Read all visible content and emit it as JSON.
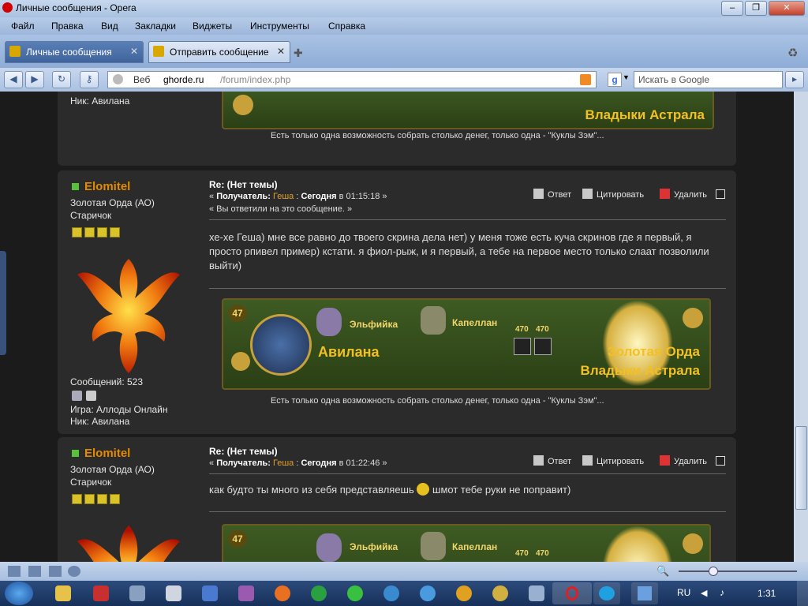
{
  "window": {
    "title": "Личные сообщения - Opera"
  },
  "menu": [
    "Файл",
    "Правка",
    "Вид",
    "Закладки",
    "Виджеты",
    "Инструменты",
    "Справка"
  ],
  "tabs": [
    {
      "label": "Личные сообщения"
    },
    {
      "label": "Отправить сообщение"
    }
  ],
  "address": {
    "web_label": "Веб",
    "domain": "ghorde.ru",
    "path": "/forum/index.php"
  },
  "search": {
    "placeholder": "Искать в Google"
  },
  "top_partial": {
    "nick": "Ник: Авилана",
    "banner_guild": "Владыки Астрала",
    "signature": "Есть только одна возможность собрать столько денег, только одна - \"Куклы Зэм\"..."
  },
  "posts": [
    {
      "username": "Elomitel",
      "guild": "Золотая Орда (АО)",
      "rank": "Старичок",
      "messages": "Сообщений: 523",
      "game": "Игра: Аллоды Онлайн",
      "nick": "Ник: Авилана",
      "subject": "Re: (Нет темы)",
      "recipient_label": "Получатель:",
      "recipient": "Геша",
      "date_bold": "Сегодня",
      "date_rest": "в 01:15:18",
      "replied_note": "« Вы ответили на это сообщение. »",
      "body": "хе-хе Геша) мне все равно до твоего скрина дела нет) у меня тоже есть куча скринов где я первый, я просто рпивел пример) кстати. я фиол-рыж, и я первый, а тебе на первое место только слаат позволили выйти)",
      "banner": {
        "level": "47",
        "race": "Эльфийка",
        "class": "Капеллан",
        "stat1": "470",
        "stat2": "470",
        "name": "Авилана",
        "guild1": "Золотая Орда",
        "guild2": "Владыки Астрала"
      },
      "signature": "Есть только одна возможность собрать столько денег, только одна - \"Куклы Зэм\"..."
    },
    {
      "username": "Elomitel",
      "guild": "Золотая Орда (АО)",
      "rank": "Старичок",
      "subject": "Re: (Нет темы)",
      "recipient_label": "Получатель:",
      "recipient": "Геша",
      "date_bold": "Сегодня",
      "date_rest": "в 01:22:46",
      "body": "как будто ты много из себя представляешь",
      "body_after": "шмот тебе руки не поправит)",
      "banner": {
        "level": "47",
        "race": "Эльфийка",
        "class": "Капеллан",
        "stat1": "470",
        "stat2": "470"
      }
    }
  ],
  "actions": {
    "reply": "Ответ",
    "quote": "Цитировать",
    "delete": "Удалить"
  },
  "tray": {
    "lang": "RU",
    "time": "1:31"
  }
}
